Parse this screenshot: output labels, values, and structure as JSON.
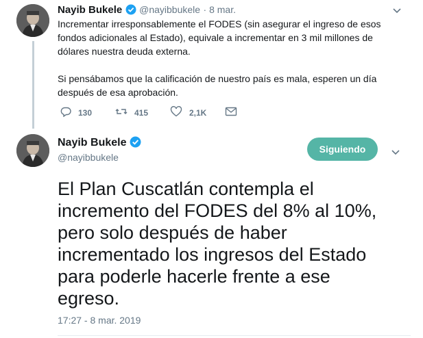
{
  "tweet1": {
    "name": "Nayib Bukele",
    "handle": "@nayibbukele",
    "time": "· 8 mar.",
    "text": "Incrementar irresponsablemente el FODES (sin asegurar el ingreso de esos\nfondos adicionales al Estado), equivale a incrementar en 3 mil millones de\ndólares nuestra deuda externa.\n\nSi pensábamos que la calificación de nuestro país es mala, esperen un día\ndespués de esa aprobación.",
    "replies": "130",
    "retweets": "415",
    "likes": "2,1K"
  },
  "tweet2": {
    "name": "Nayib Bukele",
    "handle": "@nayibbukele",
    "follow_label": "Siguiendo",
    "text": "El Plan Cuscatlán contempla el incremento del FODES del 8% al 10%, pero solo después de haber incrementado los ingresos del Estado para poderle hacerle frente a ese egreso.",
    "text_lines": [
      "El Plan Cuscatlán contempla el",
      "incremento del FODES del 8% al 10%,",
      "pero solo después de haber",
      "incrementado los ingresos del Estado",
      "para poderle hacerle frente a ese",
      "egreso."
    ],
    "timestamp": "17:27 - 8 mar. 2019"
  },
  "colors": {
    "accent": "#55b5a6",
    "verified": "#1da1f2",
    "secondary_text": "#657786",
    "thread_line": "#c4cfd6"
  },
  "icons": [
    "reply-icon",
    "retweet-icon",
    "like-icon",
    "message-icon",
    "verified-badge-icon",
    "chevron-down-icon"
  ]
}
